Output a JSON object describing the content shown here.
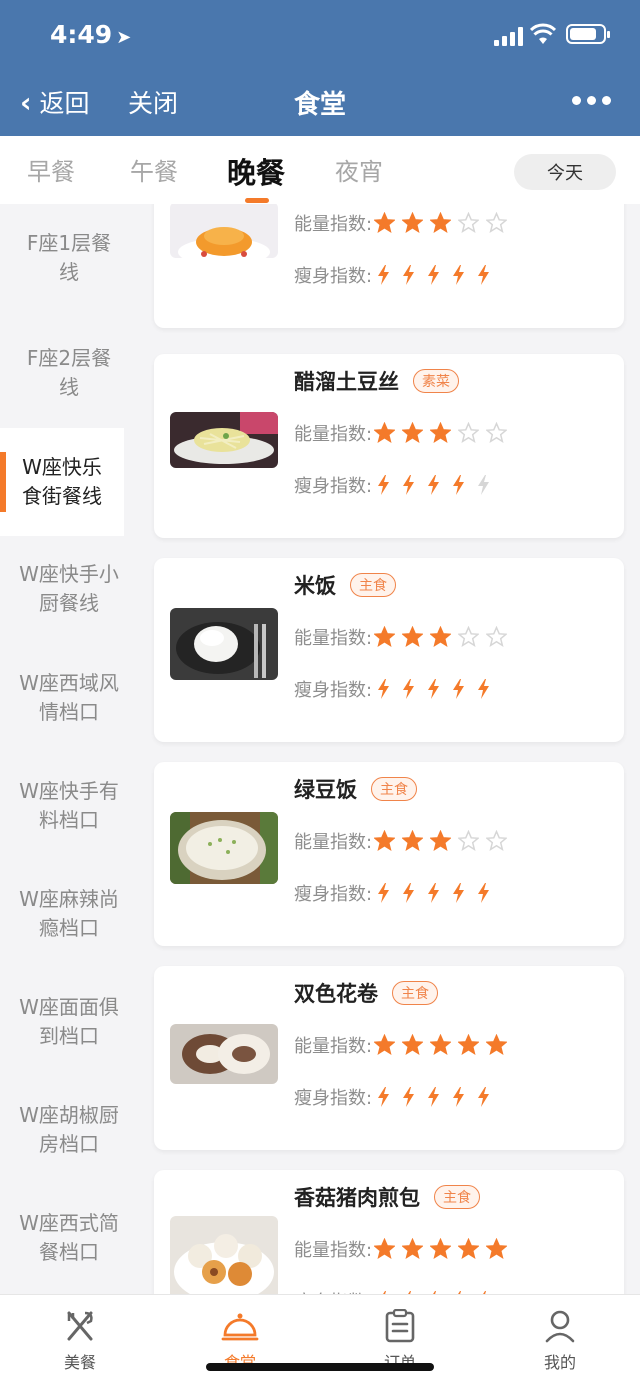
{
  "status_bar": {
    "time": "4:49"
  },
  "nav": {
    "back_label": "返回",
    "close_label": "关闭",
    "title": "食堂"
  },
  "meal_tabs": [
    {
      "label": "早餐"
    },
    {
      "label": "午餐"
    },
    {
      "label": "晚餐"
    },
    {
      "label": "夜宵"
    }
  ],
  "active_meal_tab": "晚餐",
  "today_label": "今天",
  "sidebar": {
    "active": "W座快乐食街餐线",
    "items": [
      {
        "label": "F座1层餐线"
      },
      {
        "label": "F座2层餐线"
      },
      {
        "label": "W座快乐食街餐线"
      },
      {
        "label": "W座快手小厨餐线"
      },
      {
        "label": "W座西域风情档口"
      },
      {
        "label": "W座快手有料档口"
      },
      {
        "label": "W座麻辣尚瘾档口"
      },
      {
        "label": "W座面面俱到档口"
      },
      {
        "label": "W座胡椒厨房档口"
      },
      {
        "label": "W座西式简餐档口"
      }
    ]
  },
  "metric_labels": {
    "energy": "能量指数:",
    "slim": "瘦身指数:"
  },
  "dishes": [
    {
      "name": "",
      "tag": "",
      "energy": 3,
      "slim": 5
    },
    {
      "name": "醋溜土豆丝",
      "tag": "素菜",
      "energy": 3,
      "slim": 4
    },
    {
      "name": "米饭",
      "tag": "主食",
      "energy": 3,
      "slim": 5
    },
    {
      "name": "绿豆饭",
      "tag": "主食",
      "energy": 3,
      "slim": 5
    },
    {
      "name": "双色花卷",
      "tag": "主食",
      "energy": 5,
      "slim": 5
    },
    {
      "name": "香菇猪肉煎包",
      "tag": "主食",
      "energy": 5,
      "slim": 5
    }
  ],
  "max_rating": 5,
  "bottom_tabs": [
    {
      "label": "美餐",
      "icon": "fork-knife-icon"
    },
    {
      "label": "食堂",
      "icon": "cloche-icon"
    },
    {
      "label": "订单",
      "icon": "clipboard-icon"
    },
    {
      "label": "我的",
      "icon": "user-icon"
    }
  ],
  "active_bottom_tab": "食堂",
  "colors": {
    "accent": "#f47a2a",
    "header": "#4a77ad",
    "inactive": "#d6d6d6"
  }
}
